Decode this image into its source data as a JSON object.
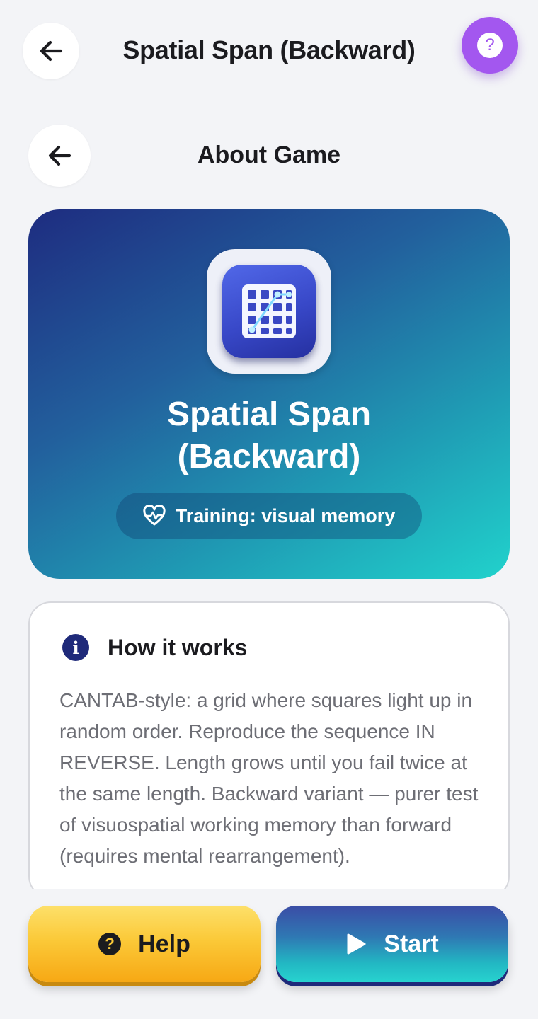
{
  "header": {
    "title": "Spatial Span (Backward)",
    "back_icon": "arrow-left-icon",
    "help_icon": "question-icon",
    "help_glyph": "?"
  },
  "section": {
    "title": "About Game",
    "back_icon": "arrow-left-icon"
  },
  "hero": {
    "title": "Spatial Span\n(Backward)",
    "icon": "grid-path-icon",
    "training_label": "Training: visual memory",
    "training_icon": "heart-pulse-icon"
  },
  "how_it_works": {
    "title": "How it works",
    "icon": "info-icon",
    "icon_glyph": "i",
    "text": "CANTAB-style: a grid where squares light up in random order. Reproduce the sequence IN REVERSE. Length grows until you fail twice at the same length. Backward variant — purer test of visuospatial working memory than forward (requires mental rearrangement)."
  },
  "actions": {
    "help_label": "Help",
    "help_icon": "question-circle-icon",
    "help_glyph": "?",
    "start_label": "Start",
    "start_icon": "play-icon"
  },
  "colors": {
    "background": "#f3f4f7",
    "accent_purple": "#a357ef",
    "hero_start": "#1e2c80",
    "hero_end": "#21d2cc",
    "help_button": "#fbc938",
    "start_button": "#22b7c3"
  }
}
